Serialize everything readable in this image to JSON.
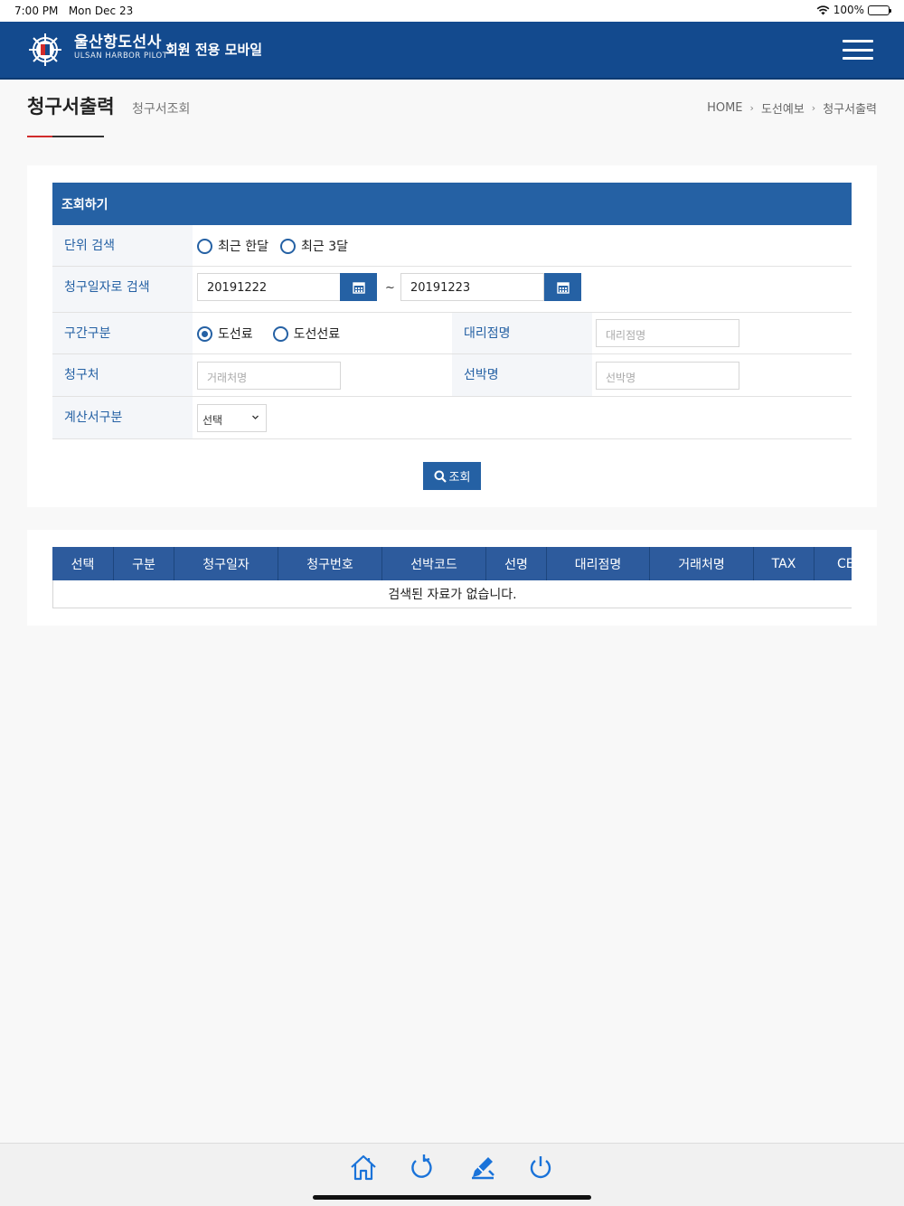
{
  "status_bar": {
    "time": "7:00 PM",
    "date": "Mon Dec 23",
    "battery": "100%"
  },
  "header": {
    "brand_ko": "울산항도선사",
    "brand_en": "ULSAN HARBOR PILOT",
    "subtitle": "회원 전용 모바일",
    "menu_icon": "hamburger-menu-icon"
  },
  "page": {
    "title": "청구서출력",
    "subtitle": "청구서조회"
  },
  "breadcrumb": [
    "HOME",
    "도선예보",
    "청구서출력"
  ],
  "search": {
    "heading": "조회하기",
    "unit_search": {
      "label": "단위 검색",
      "options": [
        "최근 한달",
        "최근 3달"
      ],
      "selected": null
    },
    "date_search": {
      "label": "청구일자로 검색",
      "from": "20191222",
      "to": "20191223",
      "separator": "~"
    },
    "section": {
      "label": "구간구분",
      "options": [
        "도선료",
        "도선선료"
      ],
      "selected": "도선료"
    },
    "agency": {
      "label": "대리점명",
      "placeholder": "대리점명"
    },
    "billto": {
      "label": "청구처",
      "placeholder": "거래처명"
    },
    "ship": {
      "label": "선박명",
      "placeholder": "선박명"
    },
    "invoice_type": {
      "label": "계산서구분",
      "value": "선택"
    },
    "button": "조회"
  },
  "results": {
    "columns": [
      "선택",
      "구분",
      "청구일자",
      "청구번호",
      "선박코드",
      "선명",
      "대리점명",
      "거래처명",
      "TAX",
      "CE"
    ],
    "empty_message": "검색된 자료가 없습니다."
  },
  "bottom_bar": [
    "home-icon",
    "refresh-icon",
    "edit-icon",
    "power-icon"
  ],
  "colors": {
    "header": "#134a8e",
    "accent": "#2561a4",
    "table_head": "#2d5b9d"
  }
}
